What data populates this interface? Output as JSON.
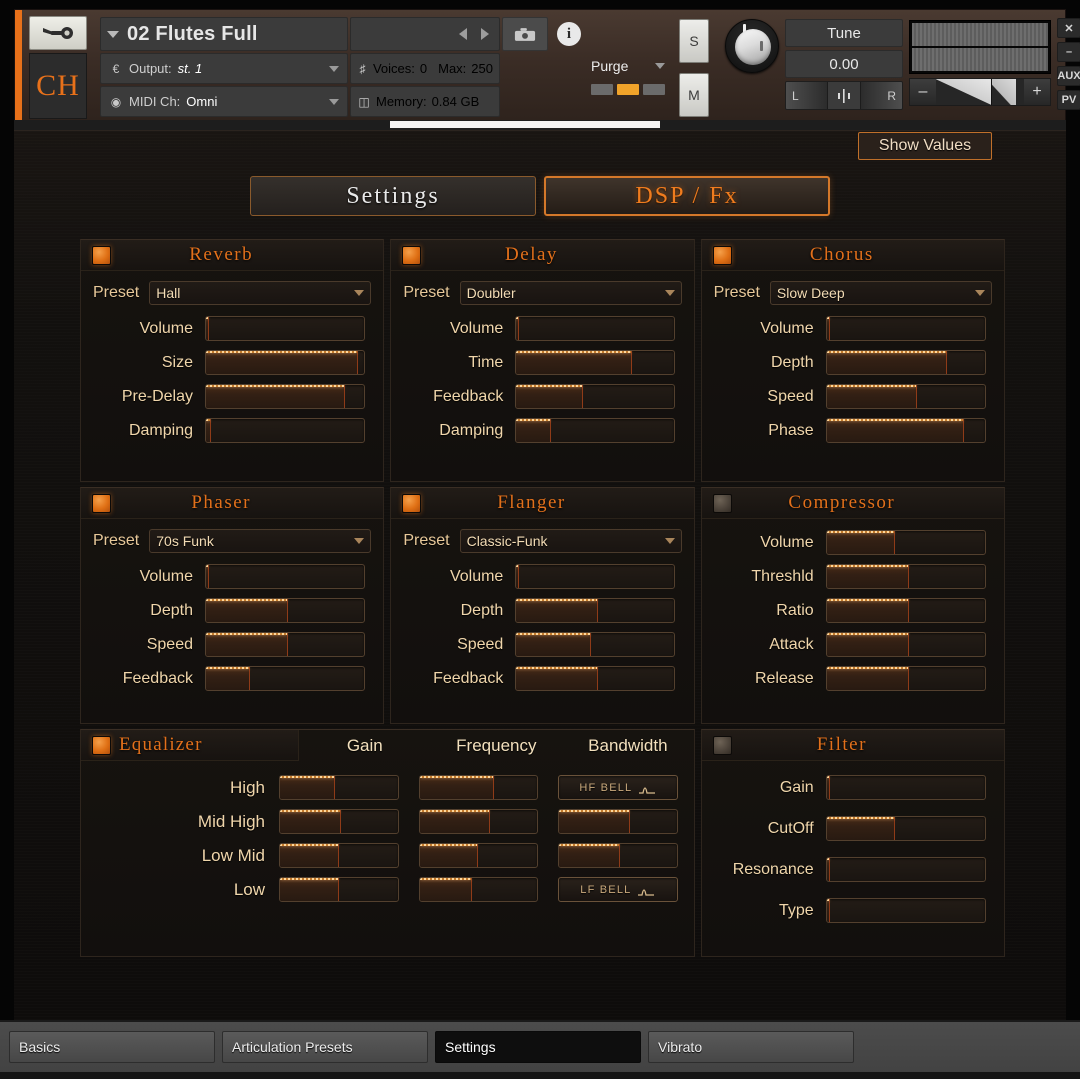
{
  "window": {
    "logo_text": "CH",
    "wrench_icon": "wrench-icon",
    "rail_buttons": [
      "X",
      "–",
      "AUX",
      "PV"
    ]
  },
  "header": {
    "instrument_name": "02 Flutes Full",
    "output_label": "Output:",
    "output_value": "st. 1",
    "midi_label": "MIDI Ch:",
    "midi_value": "Omni",
    "voices_label": "Voices:",
    "voices_value": "0",
    "max_label": "Max:",
    "max_value": "250",
    "memory_label": "Memory:",
    "memory_value": "0.84 GB",
    "purge_label": "Purge",
    "solo_label": "S",
    "mute_label": "M",
    "tune_label": "Tune",
    "tune_value": "0.00",
    "pan_left": "L",
    "pan_right": "R",
    "vol_minus": "–",
    "vol_plus": "+",
    "camera_icon": "camera-icon",
    "info_icon": "info-icon",
    "prev_icon": "prev-arrow-icon",
    "next_icon": "next-arrow-icon"
  },
  "toolbar": {
    "show_values_label": "Show Values"
  },
  "main_tabs": [
    {
      "label": "Settings",
      "active": false
    },
    {
      "label": "DSP / Fx",
      "active": true
    }
  ],
  "accent": {
    "orange": "#e2701b",
    "orange_bright": "#f07c1e",
    "cream": "#f0d6ab",
    "led_on": "#df6f14"
  },
  "fx": {
    "reverb": {
      "title": "Reverb",
      "power": "on",
      "preset_label": "Preset",
      "preset_value": "Hall",
      "controls": [
        {
          "label": "Volume",
          "value": 2
        },
        {
          "label": "Size",
          "value": 96
        },
        {
          "label": "Pre-Delay",
          "value": 88
        },
        {
          "label": "Damping",
          "value": 3
        }
      ]
    },
    "delay": {
      "title": "Delay",
      "power": "on",
      "preset_label": "Preset",
      "preset_value": "Doubler",
      "controls": [
        {
          "label": "Volume",
          "value": 2
        },
        {
          "label": "Time",
          "value": 73
        },
        {
          "label": "Feedback",
          "value": 42
        },
        {
          "label": "Damping",
          "value": 22
        }
      ]
    },
    "chorus": {
      "title": "Chorus",
      "power": "on",
      "preset_label": "Preset",
      "preset_value": "Slow Deep",
      "controls": [
        {
          "label": "Volume",
          "value": 2
        },
        {
          "label": "Depth",
          "value": 76
        },
        {
          "label": "Speed",
          "value": 57
        },
        {
          "label": "Phase",
          "value": 87
        }
      ]
    },
    "phaser": {
      "title": "Phaser",
      "power": "on",
      "preset_label": "Preset",
      "preset_value": "70s Funk",
      "controls": [
        {
          "label": "Volume",
          "value": 2
        },
        {
          "label": "Depth",
          "value": 52
        },
        {
          "label": "Speed",
          "value": 52
        },
        {
          "label": "Feedback",
          "value": 28
        }
      ]
    },
    "flanger": {
      "title": "Flanger",
      "power": "on",
      "preset_label": "Preset",
      "preset_value": "Classic-Funk",
      "controls": [
        {
          "label": "Volume",
          "value": 2
        },
        {
          "label": "Depth",
          "value": 52
        },
        {
          "label": "Speed",
          "value": 47
        },
        {
          "label": "Feedback",
          "value": 52
        }
      ]
    },
    "compressor": {
      "title": "Compressor",
      "power": "off",
      "controls": [
        {
          "label": "Volume",
          "value": 43
        },
        {
          "label": "Threshld",
          "value": 52
        },
        {
          "label": "Ratio",
          "value": 52
        },
        {
          "label": "Attack",
          "value": 52
        },
        {
          "label": "Release",
          "value": 52
        }
      ]
    },
    "equalizer": {
      "title": "Equalizer",
      "power": "on",
      "columns": [
        "Gain",
        "Frequency",
        "Bandwidth"
      ],
      "bands": [
        {
          "label": "High",
          "gain": 47,
          "frequency": 63,
          "bandwidth_type": "button",
          "bandwidth_label": "HF BELL"
        },
        {
          "label": "Mid High",
          "gain": 52,
          "frequency": 60,
          "bandwidth_type": "slider",
          "bandwidth": 60
        },
        {
          "label": "Low Mid",
          "gain": 50,
          "frequency": 50,
          "bandwidth_type": "slider",
          "bandwidth": 52
        },
        {
          "label": "Low",
          "gain": 50,
          "frequency": 45,
          "bandwidth_type": "button",
          "bandwidth_label": "LF BELL"
        }
      ]
    },
    "filter": {
      "title": "Filter",
      "power": "off",
      "controls": [
        {
          "label": "Gain",
          "value": 2
        },
        {
          "label": "CutOff",
          "value": 43
        },
        {
          "label": "Resonance",
          "value": 2
        },
        {
          "label": "Type",
          "value": 2
        }
      ]
    }
  },
  "bottom_tabs": [
    {
      "label": "Basics",
      "active": false
    },
    {
      "label": "Articulation Presets",
      "active": false
    },
    {
      "label": "Settings",
      "active": true
    },
    {
      "label": "Vibrato",
      "active": false
    }
  ]
}
